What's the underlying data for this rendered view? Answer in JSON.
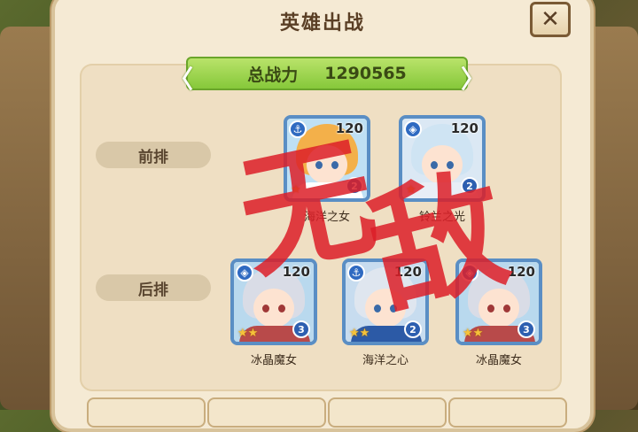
{
  "dialog": {
    "title": "英雄出战",
    "close_label": "✕"
  },
  "power": {
    "label": "总战力",
    "value": "1290565"
  },
  "rows": {
    "front_label": "前排",
    "back_label": "后排"
  },
  "front_heroes": [
    {
      "name": "海洋之女",
      "level": "120",
      "stars": "2",
      "class_icon": "anchor-icon",
      "hair_color": "#f3b04a",
      "cloth_color": "#ffffff"
    },
    {
      "name": "铃兰之光",
      "level": "120",
      "stars": "2",
      "class_icon": "shield-icon",
      "hair_color": "#cfe4f3",
      "cloth_color": "#e8eef6"
    }
  ],
  "back_heroes": [
    {
      "name": "冰晶魔女",
      "level": "120",
      "stars": "3",
      "class_icon": "shield-icon",
      "hair_color": "#d9dce6",
      "cloth_color": "#b84a4a"
    },
    {
      "name": "海洋之心",
      "level": "120",
      "stars": "2",
      "class_icon": "anchor-icon",
      "hair_color": "#dfe6ef",
      "cloth_color": "#2c5aa6"
    },
    {
      "name": "冰晶魔女",
      "level": "120",
      "stars": "3",
      "class_icon": "shield-icon",
      "hair_color": "#d9dce6",
      "cloth_color": "#b84a4a"
    }
  ],
  "watermark": {
    "char1": "无",
    "char2": "敌"
  },
  "colors": {
    "banner_green": "#9ad64e",
    "watermark_red": "#dc1e28",
    "panel": "#efdfc3"
  }
}
